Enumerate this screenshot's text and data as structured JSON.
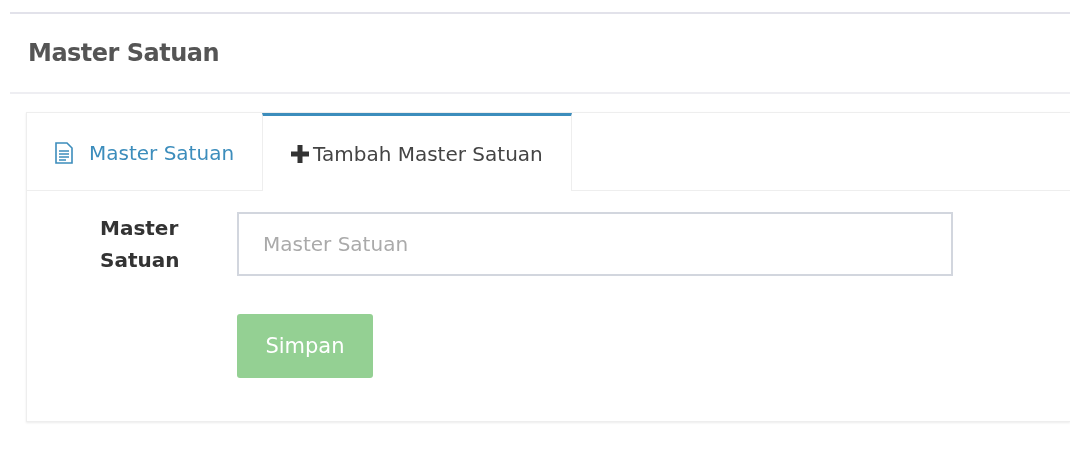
{
  "page_title": "Master Satuan",
  "tabs": [
    {
      "label": "Master Satuan",
      "kind": "list",
      "selected": false
    },
    {
      "label": "Tambah Master Satuan",
      "kind": "add",
      "selected": true
    }
  ],
  "form": {
    "label": "Master Satuan",
    "field": {
      "placeholder": "Master Satuan"
    },
    "button": {
      "label": "Simpan",
      "disabled": true
    }
  }
}
